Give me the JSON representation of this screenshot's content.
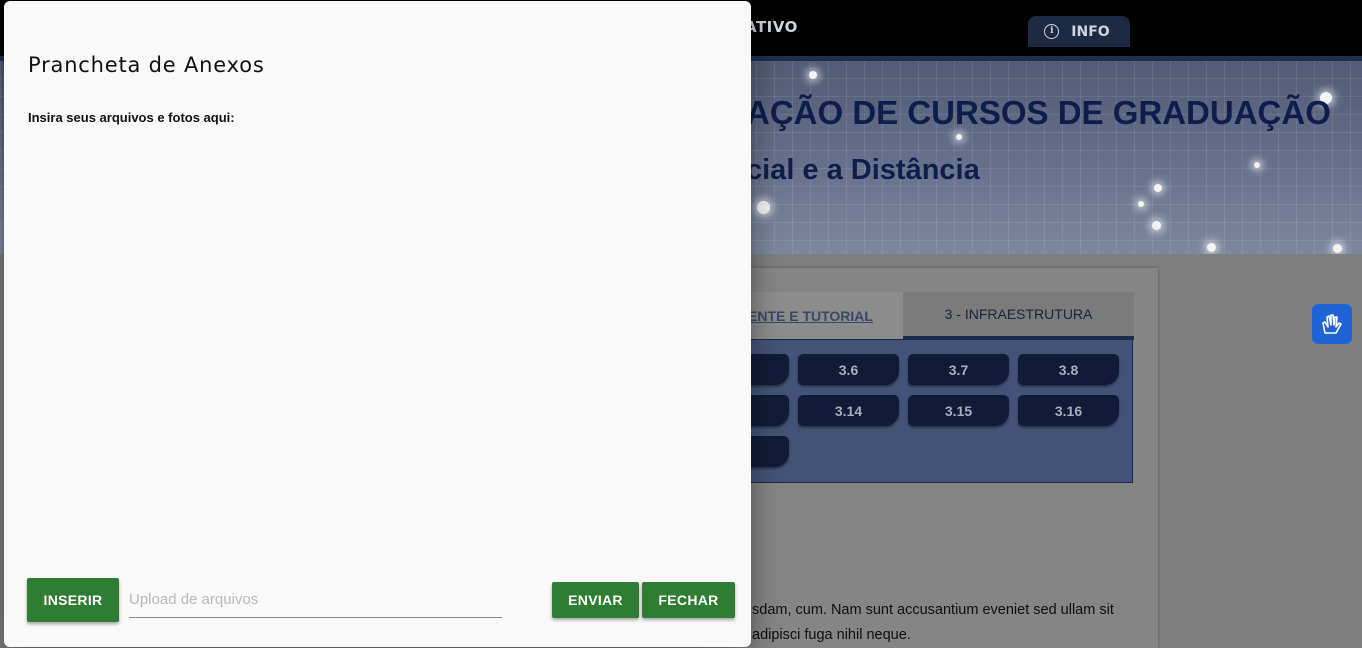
{
  "background": {
    "topbar_title": "ATIVO",
    "info_label": "INFO",
    "banner_title": "AÇÃO DE CURSOS DE GRADUAÇÃO",
    "banner_subtitle": "cial e a Distância",
    "tabs": [
      {
        "label": "ENTE E TUTORIAL"
      },
      {
        "label": "3 - INFRAESTRUTURA"
      }
    ],
    "chips": [
      "3.6",
      "3.7",
      "3.8",
      "3.14",
      "3.15",
      "3.16"
    ],
    "lorem_line1": "sdam, cum. Nam sunt accusantium eveniet sed ullam sit",
    "lorem_line2": "adipisci fuga nihil neque."
  },
  "modal": {
    "title": "Prancheta de Anexos",
    "description": "Insira seus arquivos e fotos aqui:",
    "insert_label": "INSERIR",
    "upload_placeholder": "Upload de arquivos",
    "send_label": "ENVIAR",
    "close_label": "FECHAR"
  },
  "colors": {
    "button_green": "#2e7d32",
    "navy": "#101c37",
    "accessibility_blue": "#1f63d8"
  },
  "icons": [
    "info-icon",
    "sign-language-icon"
  ]
}
